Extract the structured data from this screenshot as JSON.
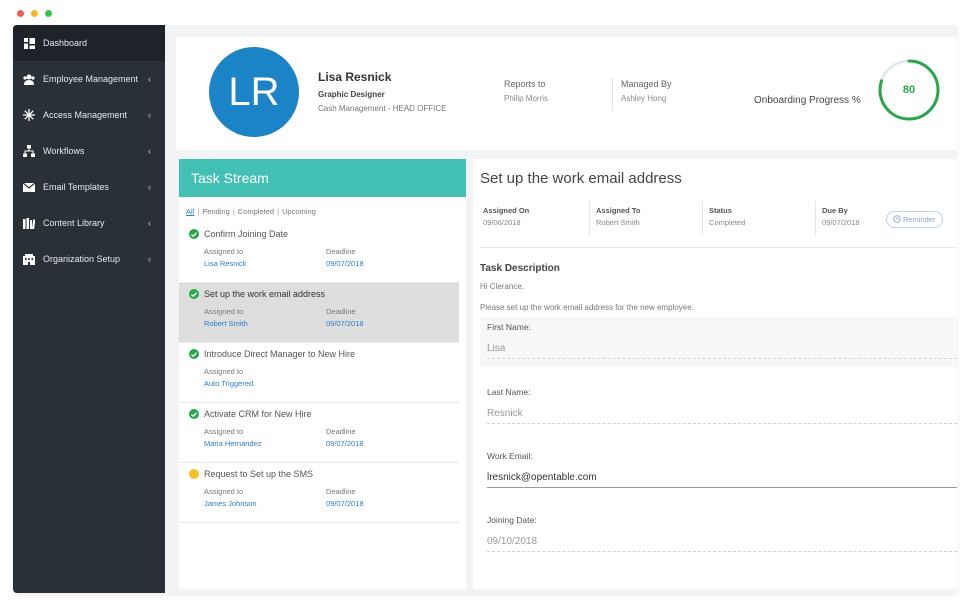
{
  "sidebar": {
    "items": [
      {
        "label": "Dashboard",
        "icon": "dashboard-icon"
      },
      {
        "label": "Employee Management",
        "icon": "users-icon"
      },
      {
        "label": "Access Management",
        "icon": "network-icon"
      },
      {
        "label": "Workflows",
        "icon": "workflow-icon"
      },
      {
        "label": "Email Templates",
        "icon": "envelope-icon"
      },
      {
        "label": "Content Library",
        "icon": "library-icon"
      },
      {
        "label": "Organization Setup",
        "icon": "building-icon"
      }
    ],
    "chevron": "‹"
  },
  "profile": {
    "initials": "LR",
    "name": "Lisa Resnick",
    "role": "Graphic Designer",
    "department": "Cash Management - HEAD OFFICE",
    "reports_to_label": "Reports to",
    "reports_to": "Philip Morris",
    "managed_by_label": "Managed By",
    "managed_by": "Ashley Hong",
    "onboarding_label": "Onboarding Progress %",
    "onboarding_progress": "80"
  },
  "tasks": {
    "title": "Task Stream",
    "filters": [
      "All",
      "Pending",
      "Completed",
      "Upcoming"
    ],
    "items": [
      {
        "title": "Confirm Joining Date",
        "assigned_label": "Assigned to",
        "assigned": "Lisa Resnick",
        "deadline_label": "Deadline",
        "deadline": "09/07/2018",
        "status": "done"
      },
      {
        "title": "Set up the work email address",
        "assigned_label": "Assigned to",
        "assigned": "Robert Smith",
        "deadline_label": "Deadline",
        "deadline": "09/07/2018",
        "status": "done"
      },
      {
        "title": "Introduce Direct Manager to New Hire",
        "assigned_label": "Assigned to",
        "assigned": "Auto Triggered",
        "deadline_label": "",
        "deadline": "",
        "status": "done"
      },
      {
        "title": "Activate CRM for New Hire",
        "assigned_label": "Assigned to",
        "assigned": "Maria Hernandez",
        "deadline_label": "Deadline",
        "deadline": "09/07/2018",
        "status": "done"
      },
      {
        "title": "Request to Set up the SMS",
        "assigned_label": "Assigned to",
        "assigned": "James Johnson",
        "deadline_label": "Deadline",
        "deadline": "09/07/2018",
        "status": "pending"
      }
    ]
  },
  "detail": {
    "title": "Set up the work email address",
    "assigned_on_label": "Assigned On",
    "assigned_on": "09/06/2018",
    "assigned_to_label": "Assigned To",
    "assigned_to": "Robert Smith",
    "status_label": "Status",
    "status": "Completed",
    "due_by_label": "Due By",
    "due_by": "09/07/2018",
    "reminder_label": "Reminder",
    "description_heading": "Task Description",
    "greeting": "Hi Clerance,",
    "instruction": "Please set up the work email address for the new employee.",
    "fields": {
      "first_name_label": "First Name:",
      "first_name": "Lisa",
      "last_name_label": "Last Name:",
      "last_name": "Resnick",
      "work_email_label": "Work Email:",
      "work_email": "lresnick@opentable.com",
      "joining_date_label": "Joining Date:",
      "joining_date": "09/10/2018"
    }
  },
  "colors": {
    "sidebar_bg": "#2a3038",
    "accent_teal": "#43c0b4",
    "avatar_blue": "#1b84c6",
    "progress_green": "#27a74a",
    "link_blue": "#2a7ec4",
    "pending_yellow": "#f5c02a"
  }
}
